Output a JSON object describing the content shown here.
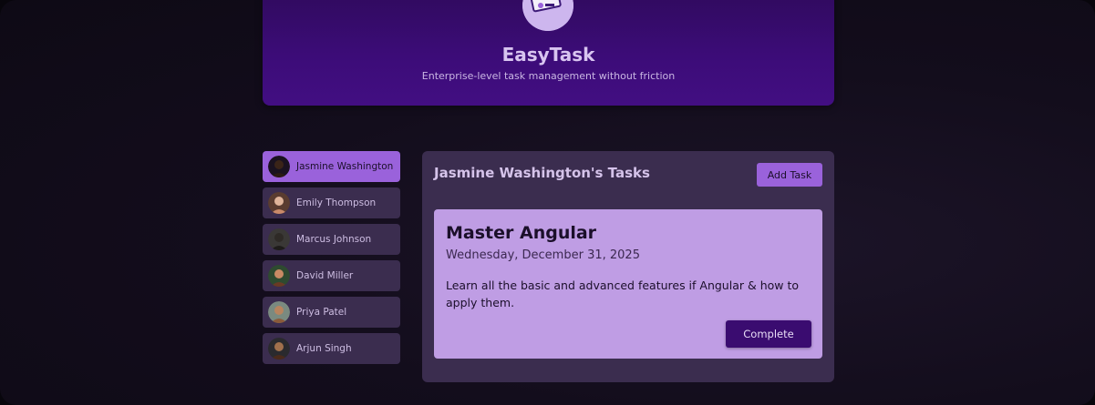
{
  "app": {
    "title": "EasyTask",
    "subtitle": "Enterprise-level task management without friction",
    "logo_icon": "task-list-icon"
  },
  "users": [
    {
      "name": "Jasmine Washington",
      "selected": true,
      "avatar_color": "#3a2418"
    },
    {
      "name": "Emily Thompson",
      "selected": false,
      "avatar_color": "#c98a6a"
    },
    {
      "name": "Marcus Johnson",
      "selected": false,
      "avatar_color": "#2e2a26"
    },
    {
      "name": "David Miller",
      "selected": false,
      "avatar_color": "#6a3a24"
    },
    {
      "name": "Priya Patel",
      "selected": false,
      "avatar_color": "#8a5a3a"
    },
    {
      "name": "Arjun Singh",
      "selected": false,
      "avatar_color": "#4a2a1a"
    }
  ],
  "tasks": {
    "heading": "Jasmine Washington's Tasks",
    "add_label": "Add Task",
    "items": [
      {
        "title": "Master Angular",
        "date": "Wednesday, December 31, 2025",
        "description": "Learn all the basic and advanced features if Angular & how to apply them.",
        "complete_label": "Complete"
      }
    ]
  },
  "colors": {
    "accent": "#9a62db",
    "header": "#3c0c78",
    "panel": "#3b2d4f",
    "card": "#bf9de4",
    "complete_button": "#3a0c70"
  }
}
